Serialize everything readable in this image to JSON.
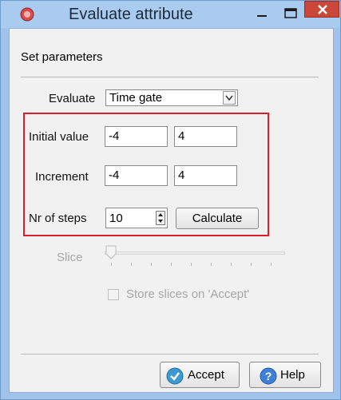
{
  "window": {
    "title": "Evaluate attribute"
  },
  "panel": {
    "heading": "Set parameters"
  },
  "evaluate": {
    "label": "Evaluate",
    "selected": "Time gate"
  },
  "initial_value": {
    "label": "Initial value",
    "from": "-4",
    "to": "4"
  },
  "increment": {
    "label": "Increment",
    "from": "-4",
    "to": "4"
  },
  "steps": {
    "label": "Nr of steps",
    "value": "10"
  },
  "buttons": {
    "calculate": "Calculate",
    "accept": "Accept",
    "help": "Help"
  },
  "slice": {
    "label": "Slice"
  },
  "store": {
    "label": "Store slices on 'Accept'"
  },
  "colors": {
    "highlight": "#d9202a",
    "close": "#c9483a",
    "titlebar": "#a9cbef"
  }
}
